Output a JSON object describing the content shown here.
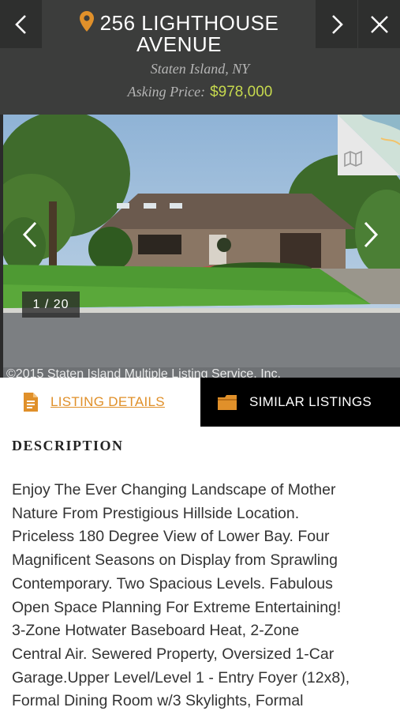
{
  "header": {
    "address": "256 LIGHTHOUSE AVENUE",
    "location": "Staten Island, NY",
    "price_label": "Asking Price:",
    "price_value": "$978,000",
    "icons": {
      "back": "chevron-left-icon",
      "next": "chevron-right-icon",
      "close": "close-icon",
      "pin": "map-pin-icon"
    },
    "accent_color": "#e0902a",
    "price_color": "#c6d94e"
  },
  "photo": {
    "counter": "1 / 20",
    "copyright": "©2015 Staten Island Multiple Listing Service, Inc.",
    "icons": {
      "prev": "chevron-left-icon",
      "next": "chevron-right-icon",
      "map": "map-icon"
    }
  },
  "tabs": {
    "details_label": "LISTING DETAILS",
    "similar_label": "SIMILAR LISTINGS",
    "details_icon": "document-icon",
    "similar_icon": "folder-icon"
  },
  "description": {
    "heading": "DESCRIPTION",
    "lines": [
      "Enjoy The Ever Changing Landscape of Mother",
      "Nature From Prestigious Hillside Location.",
      "Priceless 180 Degree View of Lower Bay. Four",
      "Magnificent Seasons on Display from Sprawling",
      "Contemporary. Two Spacious Levels. Fabulous",
      "Open Space Planning For Extreme Entertaining!",
      "3-Zone Hotwater Baseboard Heat, 2-Zone",
      "Central Air. Sewered Property, Oversized 1-Car",
      "Garage.Upper Level/Level 1 - Entry Foyer (12x8),",
      "Formal Dining Room w/3 Skylights, Formal"
    ]
  }
}
